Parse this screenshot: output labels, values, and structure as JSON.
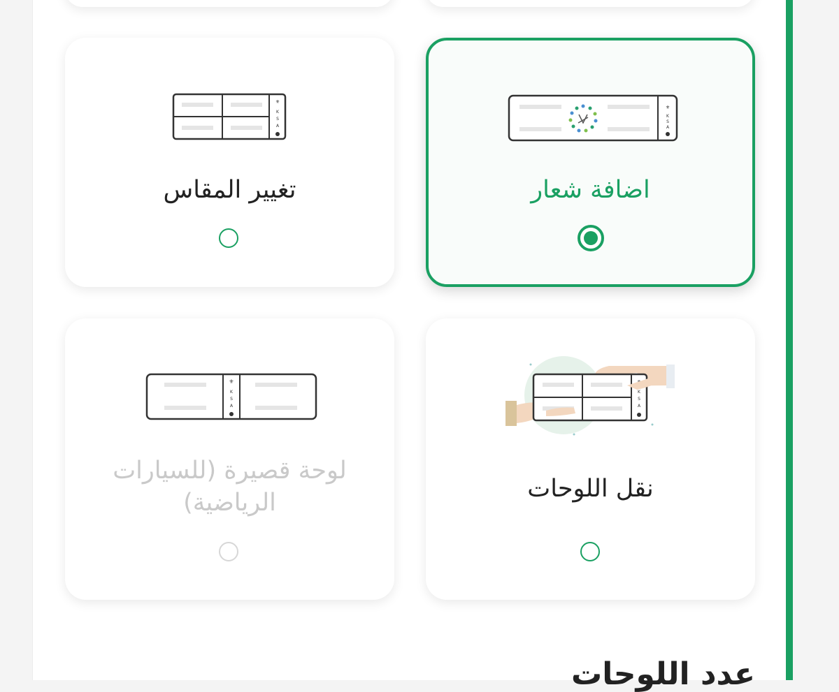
{
  "options": [
    {
      "label": "اضافة شعار",
      "selected": true,
      "disabled": false,
      "icon": "plate-logo-icon"
    },
    {
      "label": "تغيير المقاس",
      "selected": false,
      "disabled": false,
      "icon": "plate-resize-icon"
    },
    {
      "label": "نقل اللوحات",
      "selected": false,
      "disabled": false,
      "icon": "plate-transfer-icon"
    },
    {
      "label": "لوحة قصيرة (للسيارات الرياضية)",
      "selected": false,
      "disabled": true,
      "icon": "plate-short-icon"
    }
  ],
  "section": {
    "title": "عدد اللوحات"
  },
  "colors": {
    "accent": "#1aa062",
    "disabled": "#c9c9c9",
    "text": "#222222"
  }
}
